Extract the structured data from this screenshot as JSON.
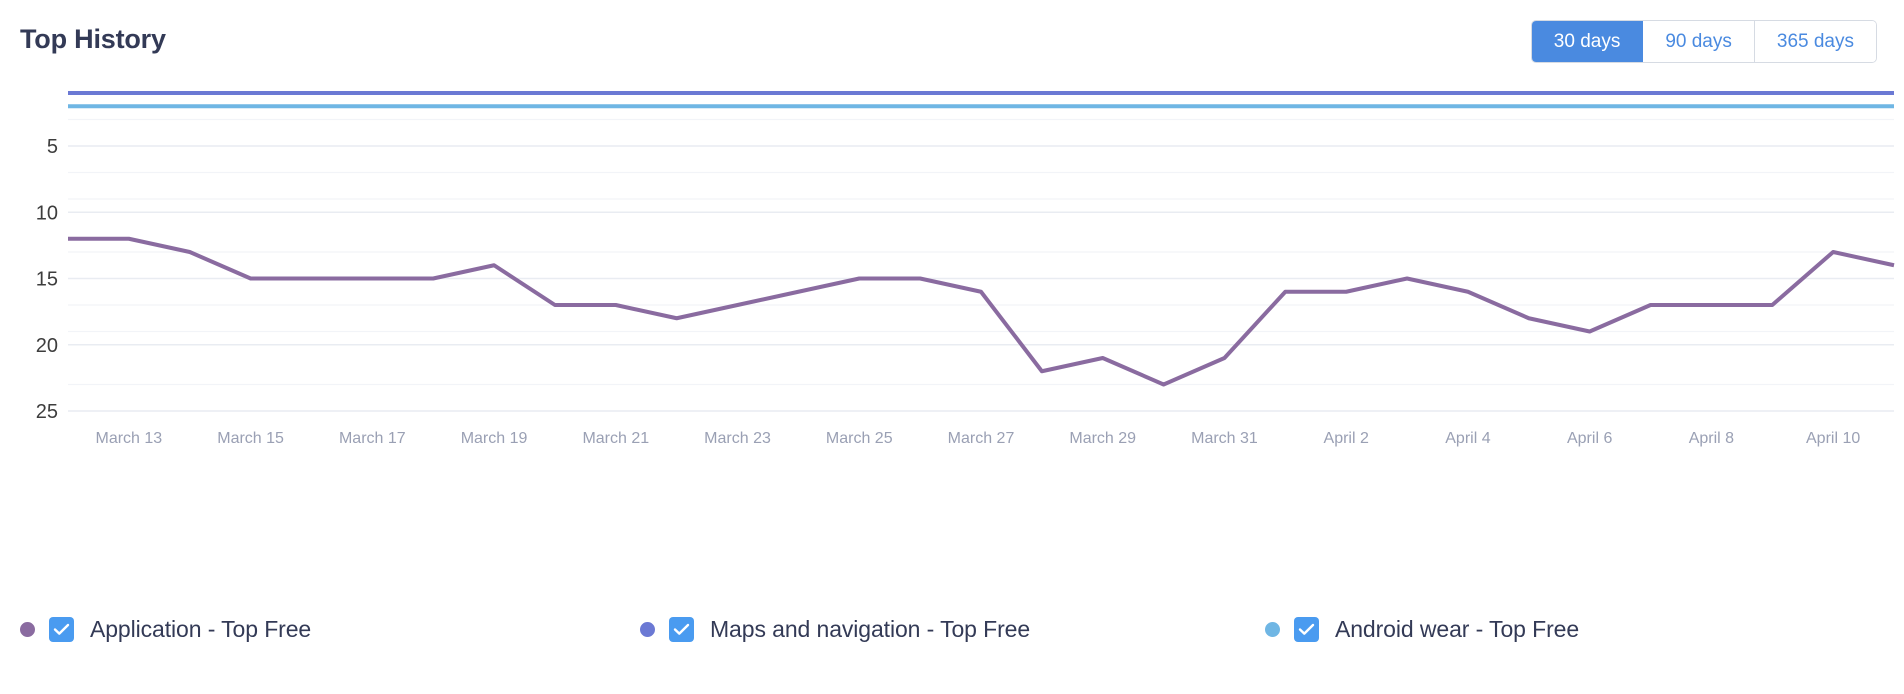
{
  "header": {
    "title": "Top History",
    "range_buttons": [
      {
        "label": "30 days",
        "active": true
      },
      {
        "label": "90 days",
        "active": false
      },
      {
        "label": "365 days",
        "active": false
      }
    ]
  },
  "legend": {
    "items": [
      {
        "label": "Application - Top Free",
        "dot_color": "#8a6ba0",
        "checked": true,
        "checkbox_color": "#4a9bf0"
      },
      {
        "label": "Maps and navigation - Top Free",
        "dot_color": "#6b79d4",
        "checked": true,
        "checkbox_color": "#4a9bf0"
      },
      {
        "label": "Android wear - Top Free",
        "dot_color": "#6fb6e4",
        "checked": true,
        "checkbox_color": "#4a9bf0"
      }
    ]
  },
  "chart_data": {
    "type": "line",
    "title": "Top History",
    "xlabel": "",
    "ylabel": "",
    "y_inverted": true,
    "ylim": [
      1,
      25
    ],
    "yticks": [
      5,
      10,
      15,
      20,
      25
    ],
    "minor_gridlines": [
      3,
      7,
      9,
      13,
      17,
      19,
      23
    ],
    "grid": true,
    "legend_position": "bottom",
    "x": [
      "March 12",
      "March 13",
      "March 14",
      "March 15",
      "March 16",
      "March 17",
      "March 18",
      "March 19",
      "March 20",
      "March 21",
      "March 22",
      "March 23",
      "March 24",
      "March 25",
      "March 26",
      "March 27",
      "March 28",
      "March 29",
      "March 30",
      "March 31",
      "April 1",
      "April 2",
      "April 3",
      "April 4",
      "April 5",
      "April 6",
      "April 7",
      "April 8",
      "April 9",
      "April 10",
      "April 11"
    ],
    "xticks": [
      "March 13",
      "March 15",
      "March 17",
      "March 19",
      "March 21",
      "March 23",
      "March 25",
      "March 27",
      "March 29",
      "March 31",
      "April 2",
      "April 4",
      "April 6",
      "April 8",
      "April 10",
      "."
    ],
    "series": [
      {
        "name": "Application - Top Free",
        "color": "#8a6ba0",
        "values": [
          12,
          12,
          13,
          15,
          15,
          15,
          15,
          14,
          17,
          17,
          18,
          17,
          16,
          15,
          15,
          16,
          22,
          21,
          23,
          21,
          16,
          16,
          15,
          16,
          18,
          19,
          17,
          17,
          17,
          13,
          14
        ]
      },
      {
        "name": "Maps and navigation - Top Free",
        "color": "#6b79d4",
        "values": [
          1,
          1,
          1,
          1,
          1,
          1,
          1,
          1,
          1,
          1,
          1,
          1,
          1,
          1,
          1,
          1,
          1,
          1,
          1,
          1,
          1,
          1,
          1,
          1,
          1,
          1,
          1,
          1,
          1,
          1,
          1
        ]
      },
      {
        "name": "Android wear - Top Free",
        "color": "#6fb6e4",
        "values": [
          2,
          2,
          2,
          2,
          2,
          2,
          2,
          2,
          2,
          2,
          2,
          2,
          2,
          2,
          2,
          2,
          2,
          2,
          2,
          2,
          2,
          2,
          2,
          2,
          2,
          2,
          2,
          2,
          2,
          2,
          2
        ]
      }
    ]
  }
}
